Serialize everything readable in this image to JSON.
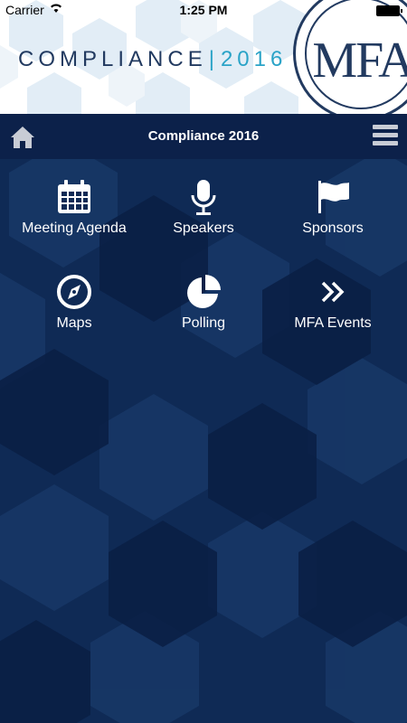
{
  "status_bar": {
    "carrier": "Carrier",
    "time": "1:25 PM"
  },
  "banner": {
    "title": "COMPLIANCE",
    "separator": "|",
    "year": "2016",
    "logo_text": "MFA"
  },
  "navbar": {
    "title": "Compliance 2016"
  },
  "menu": {
    "items": [
      {
        "label": "Meeting Agenda",
        "icon": "calendar-icon"
      },
      {
        "label": "Speakers",
        "icon": "microphone-icon"
      },
      {
        "label": "Sponsors",
        "icon": "flag-icon"
      },
      {
        "label": "Maps",
        "icon": "compass-icon"
      },
      {
        "label": "Polling",
        "icon": "pie-chart-icon"
      },
      {
        "label": "MFA Events",
        "icon": "double-chevron-right-icon"
      }
    ]
  },
  "colors": {
    "navy": "#0c214a",
    "background": "#0f2a55",
    "accent": "#2aa3c7"
  }
}
